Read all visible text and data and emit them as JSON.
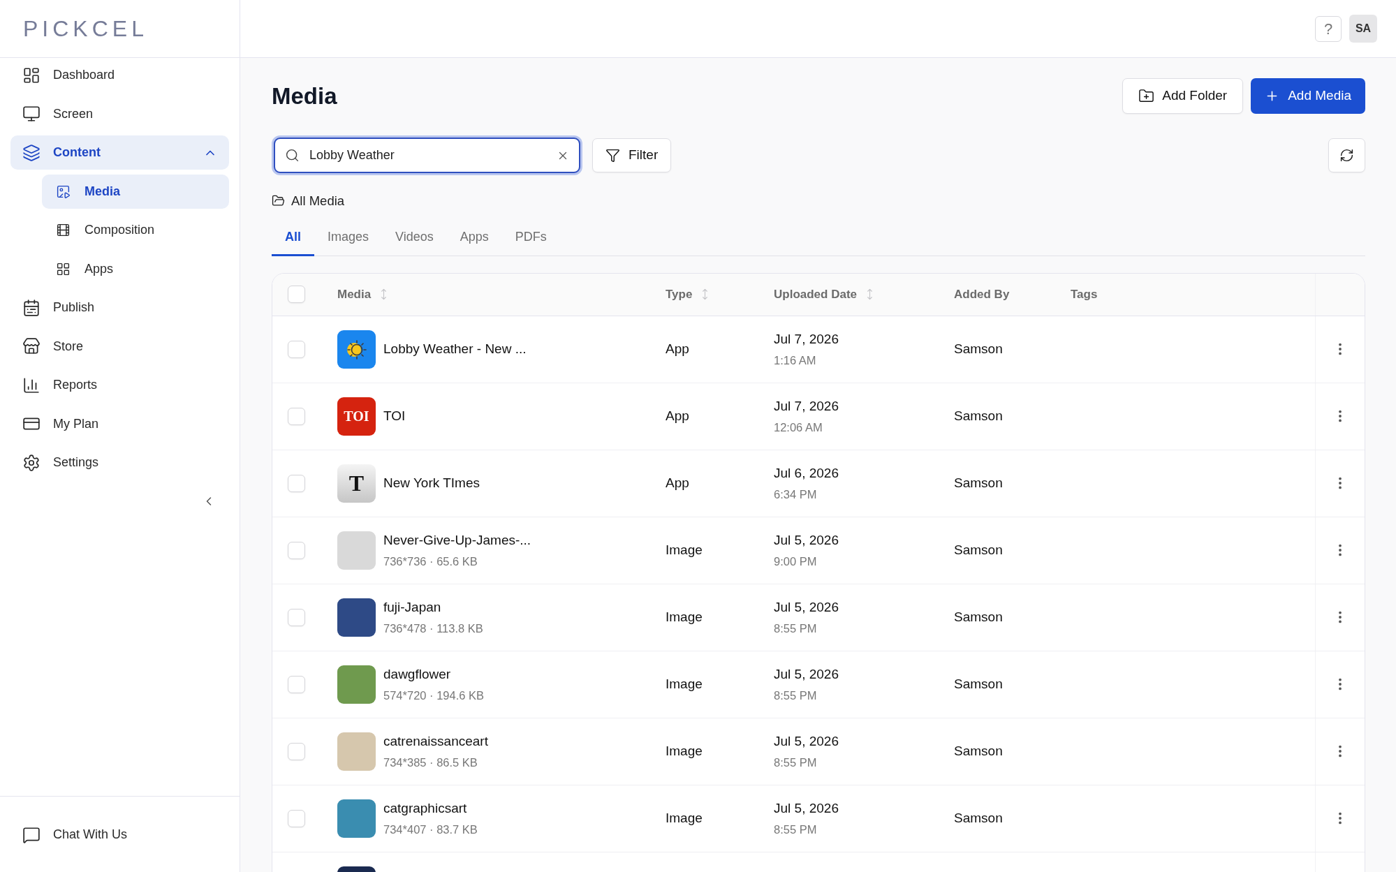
{
  "sidebar": {
    "logo": "PICKCEL",
    "items": [
      {
        "label": "Dashboard",
        "selected": false
      },
      {
        "label": "Screen",
        "selected": false
      },
      {
        "label": "Content",
        "selected": true,
        "expanded": true,
        "children": [
          {
            "label": "Media",
            "selected": true
          },
          {
            "label": "Composition",
            "selected": false
          },
          {
            "label": "Apps",
            "selected": false
          }
        ]
      },
      {
        "label": "Publish",
        "selected": false
      },
      {
        "label": "Store",
        "selected": false
      },
      {
        "label": "Reports",
        "selected": false
      },
      {
        "label": "My Plan",
        "selected": false
      },
      {
        "label": "Settings",
        "selected": false
      }
    ],
    "chat": "Chat With Us"
  },
  "header": {
    "help": "?",
    "avatar": "SA"
  },
  "page": {
    "title": "Media",
    "buttons": [
      {
        "label": "Add Folder",
        "kind": "secondary"
      },
      {
        "label": "Add Media",
        "kind": "primary"
      }
    ]
  },
  "search": {
    "value": "Lobby Weather",
    "focused": true
  },
  "filter": "Filter",
  "breadcrumb": "All Media",
  "tabs": [
    {
      "label": "All",
      "selected": true
    },
    {
      "label": "Images",
      "selected": false
    },
    {
      "label": "Videos",
      "selected": false
    },
    {
      "label": "Apps",
      "selected": false
    },
    {
      "label": "PDFs",
      "selected": false
    }
  ],
  "table": {
    "select_all": {
      "checked": false
    },
    "columns": [
      {
        "label": "Media",
        "sortable": true
      },
      {
        "label": "Type",
        "sortable": true
      },
      {
        "label": "Uploaded Date",
        "sortable": true
      },
      {
        "label": "Added By",
        "sortable": false
      },
      {
        "label": "Tags",
        "sortable": false
      }
    ],
    "rows": [
      {
        "checked": false,
        "thumbnail": {
          "kind": "weather"
        },
        "name": "Lobby Weather - New ...",
        "type": "App",
        "date": "Jul 7, 2026",
        "time": "1:16 AM",
        "added_by": "Samson"
      },
      {
        "checked": false,
        "thumbnail": {
          "kind": "text-logo",
          "text": "TOI",
          "color": "#d5230f"
        },
        "name": "TOI",
        "type": "App",
        "date": "Jul 7, 2026",
        "time": "12:06 AM",
        "added_by": "Samson"
      },
      {
        "checked": false,
        "thumbnail": {
          "kind": "emblem",
          "text": "T"
        },
        "name": "New York TImes",
        "type": "App",
        "date": "Jul 6, 2026",
        "time": "6:34 PM",
        "added_by": "Samson"
      },
      {
        "checked": false,
        "thumbnail": {
          "kind": "photo",
          "color": "#d9d9d9"
        },
        "name": "Never-Give-Up-James-...",
        "details": "736*736 · 65.6 KB",
        "type": "Image",
        "date": "Jul 5, 2026",
        "time": "9:00 PM",
        "added_by": "Samson"
      },
      {
        "checked": false,
        "thumbnail": {
          "kind": "photo",
          "color": "#2e4a86"
        },
        "name": "fuji-Japan",
        "details": "736*478 · 113.8 KB",
        "type": "Image",
        "date": "Jul 5, 2026",
        "time": "8:55 PM",
        "added_by": "Samson"
      },
      {
        "checked": false,
        "thumbnail": {
          "kind": "photo",
          "color": "#6f9a4e"
        },
        "name": "dawgflower",
        "details": "574*720 · 194.6 KB",
        "type": "Image",
        "date": "Jul 5, 2026",
        "time": "8:55 PM",
        "added_by": "Samson"
      },
      {
        "checked": false,
        "thumbnail": {
          "kind": "photo",
          "color": "#d6c7ad"
        },
        "name": "catrenaissanceart",
        "details": "734*385 · 86.5 KB",
        "type": "Image",
        "date": "Jul 5, 2026",
        "time": "8:55 PM",
        "added_by": "Samson"
      },
      {
        "checked": false,
        "thumbnail": {
          "kind": "photo",
          "color": "#3a8db0"
        },
        "name": "catgraphicsart",
        "details": "734*407 · 83.7 KB",
        "type": "Image",
        "date": "Jul 5, 2026",
        "time": "8:55 PM",
        "added_by": "Samson"
      },
      {
        "thumbnail": {
          "kind": "photo",
          "color": "#1a2a50"
        }
      }
    ]
  }
}
